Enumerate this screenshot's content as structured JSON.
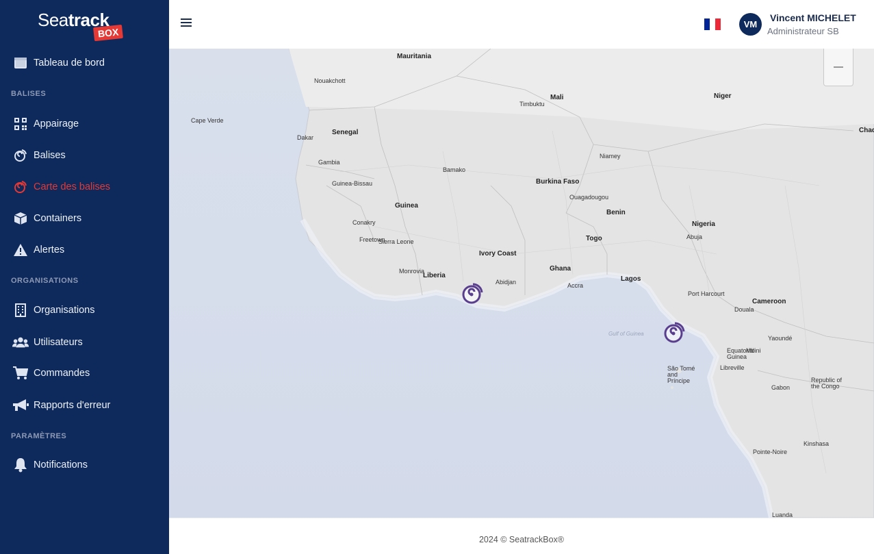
{
  "brand": {
    "name_light": "Sea",
    "name_bold": "track",
    "badge": "BOX",
    "accent_color": "#e53935",
    "sidebar_color": "#0e2a5c"
  },
  "sidebar": {
    "items": [
      {
        "label": "Tableau de bord",
        "icon": "dashboard-icon"
      },
      {
        "label": "Appairage",
        "icon": "qr-code-icon"
      },
      {
        "label": "Balises",
        "icon": "beacon-icon"
      },
      {
        "label": "Carte des balises",
        "icon": "beacon-map-icon",
        "active": true
      },
      {
        "label": "Containers",
        "icon": "box-icon"
      },
      {
        "label": "Alertes",
        "icon": "warning-icon"
      },
      {
        "label": "Organisations",
        "icon": "building-icon"
      },
      {
        "label": "Utilisateurs",
        "icon": "users-icon"
      },
      {
        "label": "Commandes",
        "icon": "cart-icon"
      },
      {
        "label": "Rapports d'erreur",
        "icon": "megaphone-icon"
      },
      {
        "label": "Notifications",
        "icon": "bell-icon"
      }
    ],
    "sections": {
      "balises": "BALISES",
      "organisations": "ORGANISATIONS",
      "parametres": "PARAMÈTRES"
    }
  },
  "header": {
    "language_flag": "france-flag-icon",
    "user": {
      "initials": "VM",
      "name": "Vincent MICHELET",
      "role": "Administrateur SB"
    }
  },
  "map": {
    "labels": {
      "mauritania": "Mauritania",
      "mali": "Mali",
      "niger": "Niger",
      "chad": "Chad",
      "senegal": "Senegal",
      "gambia": "Gambia",
      "guinea_bissau": "Guinea-Bissau",
      "guinea": "Guinea",
      "sierra_leone": "Sierra Leone",
      "liberia": "Liberia",
      "ivory_coast": "Ivory Coast",
      "ghana": "Ghana",
      "togo": "Togo",
      "benin": "Benin",
      "burkina": "Burkina Faso",
      "nigeria": "Nigeria",
      "cameroon": "Cameroon",
      "eq_guinea": "Equatorial Guinea",
      "gabon": "Gabon",
      "congo": "Republic of the Congo",
      "sao_tome": "São Tomé and Príncipe",
      "cape_verde": "Cape Verde",
      "lagos": "Lagos",
      "abuja": "Abuja",
      "freetown": "Freetown",
      "conakry": "Conakry",
      "dakar": "Dakar",
      "bamako": "Bamako",
      "niamey": "Niamey",
      "accra": "Accra",
      "abidjan": "Abidjan",
      "kinshasa": "Kinshasa",
      "libreville": "Libreville",
      "yaounde": "Yaoundé",
      "luanda": "Luanda",
      "monrovia": "Monrovia",
      "nouakchott": "Nouakchott",
      "ouagadougou": "Ouagadougou",
      "timbuktu": "Timbuktu",
      "port_harcourt": "Port Harcourt",
      "douala": "Douala",
      "pointe_noire": "Pointe-Noire",
      "gulf": "Gulf of Guinea",
      "mbini": "Mbini"
    },
    "zoom_out_label": "−",
    "markers": [
      {
        "name": "beacon-marker-1",
        "color": "#5b3f8f"
      },
      {
        "name": "beacon-marker-2",
        "color": "#5b3f8f"
      }
    ]
  },
  "footer": {
    "text": "2024 © SeatrackBox®"
  }
}
